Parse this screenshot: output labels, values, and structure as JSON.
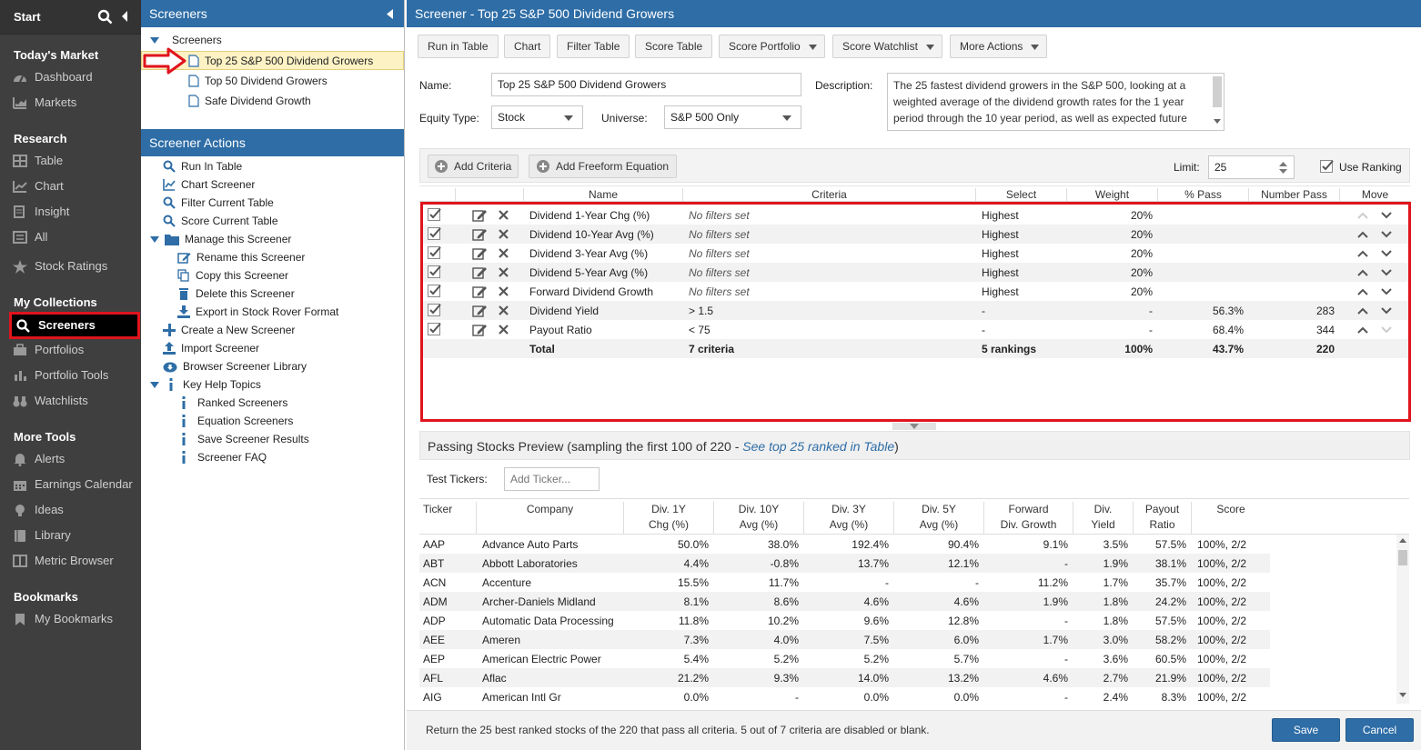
{
  "nav": {
    "start": "Start",
    "sections": [
      {
        "title": "Today's Market",
        "items": [
          "Dashboard",
          "Markets"
        ]
      },
      {
        "title": "Research",
        "items": [
          "Table",
          "Chart",
          "Insight",
          "All",
          "Stock Ratings"
        ]
      },
      {
        "title": "My Collections",
        "items": [
          "Screeners",
          "Portfolios",
          "Portfolio Tools",
          "Watchlists"
        ]
      },
      {
        "title": "More Tools",
        "items": [
          "Alerts",
          "Earnings Calendar",
          "Ideas",
          "Library",
          "Metric Browser"
        ]
      },
      {
        "title": "Bookmarks",
        "items": [
          "My Bookmarks"
        ]
      }
    ]
  },
  "tree": {
    "panel_title": "Screeners",
    "root": "Screeners",
    "screeners": [
      "Top 25 S&P 500 Dividend Growers",
      "Top 50 Dividend Growers",
      "Safe Dividend Growth"
    ],
    "actions_title": "Screener Actions",
    "actions": [
      "Run In Table",
      "Chart Screener",
      "Filter Current Table",
      "Score Current Table",
      "Manage this Screener",
      "Rename this Screener",
      "Copy this Screener",
      "Delete this Screener",
      "Export in Stock Rover Format",
      "Create a New Screener",
      "Import Screener",
      "Browser Screener Library",
      "Key Help Topics",
      "Ranked Screeners",
      "Equation Screeners",
      "Save Screener Results",
      "Screener FAQ"
    ]
  },
  "main": {
    "title": "Screener - Top 25 S&P 500 Dividend Growers",
    "toolbar": [
      "Run in Table",
      "Chart",
      "Filter Table",
      "Score Table",
      "Score Portfolio",
      "Score Watchlist",
      "More Actions"
    ],
    "form": {
      "name_label": "Name:",
      "name_value": "Top 25 S&P 500 Dividend Growers",
      "equity_label": "Equity Type:",
      "equity_value": "Stock",
      "universe_label": "Universe:",
      "universe_value": "S&P 500 Only",
      "description_label": "Description:",
      "description": "The 25 fastest dividend growers in the S&P 500, looking at a weighted average of the dividend growth rates for the 1 year period through the 10 year period, as well as expected future"
    },
    "criteria_bar": {
      "add_criteria": "Add Criteria",
      "add_freeform": "Add Freeform Equation",
      "limit_label": "Limit:",
      "limit_value": "25",
      "use_ranking": "Use Ranking"
    },
    "criteria_headers": [
      "Name",
      "Criteria",
      "Select",
      "Weight",
      "% Pass",
      "Number Pass",
      "Move"
    ],
    "criteria": [
      [
        "Dividend 1-Year Chg (%)",
        "No filters set",
        "Highest",
        "20%",
        "",
        ""
      ],
      [
        "Dividend 10-Year Avg (%)",
        "No filters set",
        "Highest",
        "20%",
        "",
        ""
      ],
      [
        "Dividend 3-Year Avg (%)",
        "No filters set",
        "Highest",
        "20%",
        "",
        ""
      ],
      [
        "Dividend 5-Year Avg (%)",
        "No filters set",
        "Highest",
        "20%",
        "",
        ""
      ],
      [
        "Forward Dividend Growth",
        "No filters set",
        "Highest",
        "20%",
        "",
        ""
      ],
      [
        "Dividend Yield",
        "> 1.5",
        "-",
        "-",
        "56.3%",
        "283"
      ],
      [
        "Payout Ratio",
        "< 75",
        "-",
        "-",
        "68.4%",
        "344"
      ]
    ],
    "criteria_total": [
      "Total",
      "7 criteria",
      "5 rankings",
      "100%",
      "43.7%",
      "220"
    ],
    "preview_title": "Passing Stocks Preview (sampling the first 100 of 220 - ",
    "preview_link": "See top 25 ranked in Table",
    "preview_close": ")",
    "test_tickers_label": "Test Tickers:",
    "test_tickers_placeholder": "Add Ticker...",
    "stock_headers": [
      [
        "Ticker",
        ""
      ],
      [
        "Company",
        ""
      ],
      [
        "Div. 1Y",
        "Chg (%)"
      ],
      [
        "Div. 10Y",
        "Avg (%)"
      ],
      [
        "Div. 3Y",
        "Avg (%)"
      ],
      [
        "Div. 5Y",
        "Avg (%)"
      ],
      [
        "Forward",
        "Div. Growth"
      ],
      [
        "Div.",
        "Yield"
      ],
      [
        "Payout",
        "Ratio"
      ],
      [
        "Score",
        ""
      ]
    ],
    "stocks": [
      [
        "AAP",
        "Advance Auto Parts",
        "50.0%",
        "38.0%",
        "192.4%",
        "90.4%",
        "9.1%",
        "3.5%",
        "57.5%",
        "100%, 2/2"
      ],
      [
        "ABT",
        "Abbott Laboratories",
        "4.4%",
        "-0.8%",
        "13.7%",
        "12.1%",
        "-",
        "1.9%",
        "38.1%",
        "100%, 2/2"
      ],
      [
        "ACN",
        "Accenture",
        "15.5%",
        "11.7%",
        "-",
        "-",
        "11.2%",
        "1.7%",
        "35.7%",
        "100%, 2/2"
      ],
      [
        "ADM",
        "Archer-Daniels Midland",
        "8.1%",
        "8.6%",
        "4.6%",
        "4.6%",
        "1.9%",
        "1.8%",
        "24.2%",
        "100%, 2/2"
      ],
      [
        "ADP",
        "Automatic Data Processing",
        "11.8%",
        "10.2%",
        "9.6%",
        "12.8%",
        "-",
        "1.8%",
        "57.5%",
        "100%, 2/2"
      ],
      [
        "AEE",
        "Ameren",
        "7.3%",
        "4.0%",
        "7.5%",
        "6.0%",
        "1.7%",
        "3.0%",
        "58.2%",
        "100%, 2/2"
      ],
      [
        "AEP",
        "American Electric Power",
        "5.4%",
        "5.2%",
        "5.2%",
        "5.7%",
        "-",
        "3.6%",
        "60.5%",
        "100%, 2/2"
      ],
      [
        "AFL",
        "Aflac",
        "21.2%",
        "9.3%",
        "14.0%",
        "13.2%",
        "4.6%",
        "2.7%",
        "21.9%",
        "100%, 2/2"
      ],
      [
        "AIG",
        "American Intl Gr",
        "0.0%",
        "-",
        "0.0%",
        "0.0%",
        "-",
        "2.4%",
        "8.3%",
        "100%, 2/2"
      ]
    ],
    "footer_text": "Return the 25 best ranked stocks of the 220 that pass all criteria. 5 out of 7 criteria are disabled or blank.",
    "save": "Save",
    "cancel": "Cancel"
  },
  "colors": {
    "nav_bg": "#3f3f3f",
    "accent": "#2e6da6",
    "highlight": "#e0141d",
    "selected_row": "#fdf2c4"
  }
}
